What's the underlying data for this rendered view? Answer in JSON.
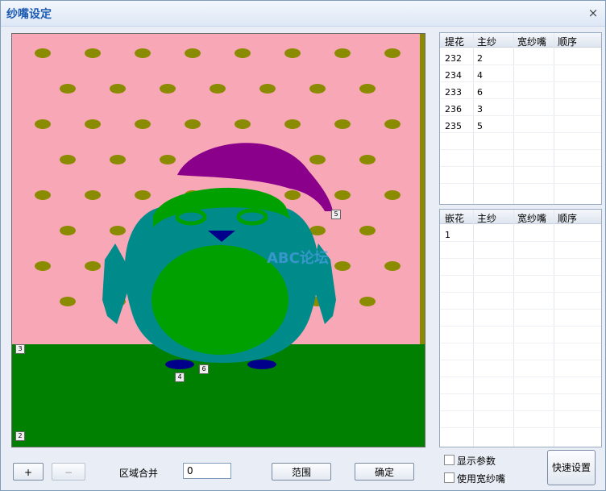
{
  "window": {
    "title": "纱嘴设定",
    "close_glyph": "×"
  },
  "canvas": {
    "colors": {
      "background": "#f8a7b6",
      "dots": "#8b8b00",
      "floor": "#008000",
      "body": "#008b8b",
      "belly": "#00a000",
      "hat": "#8b008b",
      "brim": "#00a000",
      "beak": "#00008b",
      "feet": "#00008b"
    },
    "markers": [
      "5",
      "3",
      "4",
      "6",
      "2"
    ]
  },
  "watermark": {
    "text": "ABC论坛"
  },
  "table1": {
    "headers": [
      "提花",
      "主纱",
      "宽纱嘴",
      "顺序"
    ],
    "rows": [
      [
        "232",
        "2",
        "",
        ""
      ],
      [
        "234",
        "4",
        "",
        ""
      ],
      [
        "233",
        "6",
        "",
        ""
      ],
      [
        "236",
        "3",
        "",
        ""
      ],
      [
        "235",
        "5",
        "",
        ""
      ]
    ]
  },
  "table2": {
    "headers": [
      "嵌花",
      "主纱",
      "宽纱嘴",
      "顺序"
    ],
    "rows": [
      [
        "1",
        "",
        "",
        ""
      ]
    ]
  },
  "bottom": {
    "add_label": "+",
    "remove_label": "−",
    "merge_label": "区域合并",
    "merge_value": "0",
    "range_label": "范围",
    "ok_label": "确定",
    "show_params_label": "显示参数",
    "use_wide_label": "使用宽纱嘴",
    "quick_label": "快速设置"
  }
}
